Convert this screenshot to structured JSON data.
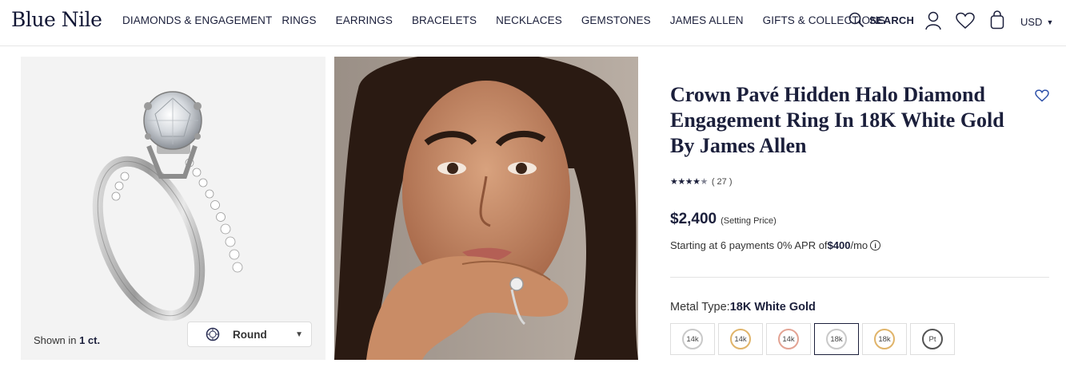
{
  "header": {
    "logo": "Blue Nile",
    "nav": [
      "DIAMONDS & ENGAGEMENT",
      "RINGS",
      "EARRINGS",
      "BRACELETS",
      "NECKLACES",
      "GEMSTONES",
      "JAMES ALLEN",
      "GIFTS & COLLECTIONS"
    ],
    "search_label": "SEARCH",
    "currency": "USD",
    "icons": [
      "search-icon",
      "account-icon",
      "wishlist-heart-icon",
      "shopping-bag-icon"
    ]
  },
  "gallery": {
    "shown_in_prefix": "Shown in ",
    "shown_in_value": "1 ct.",
    "shape_select": "Round"
  },
  "product": {
    "title": "Crown Pavé Hidden Halo Diamond Engagement Ring In 18K White Gold By James Allen",
    "rating_value": 4.5,
    "review_count": "( 27 )",
    "price": "$2,400",
    "price_note": "(Setting Price)",
    "financing_prefix": "Starting at 6 payments 0% APR of ",
    "financing_amount": "$400",
    "financing_suffix": "/mo",
    "metal_label": "Metal Type:",
    "metal_selected": "18K White Gold",
    "metals": [
      {
        "label": "14k",
        "ring_color": "#c9c9c9"
      },
      {
        "label": "14k",
        "ring_color": "#e0b46a"
      },
      {
        "label": "14k",
        "ring_color": "#e3a393"
      },
      {
        "label": "18k",
        "ring_color": "#c9c9c9"
      },
      {
        "label": "18k",
        "ring_color": "#e0b46a"
      },
      {
        "label": "Pt",
        "ring_color": "#555555"
      }
    ],
    "selected_metal_index": 3
  },
  "colors": {
    "brand_navy": "#1b1f3b",
    "panel_gray": "#f3f3f3"
  }
}
